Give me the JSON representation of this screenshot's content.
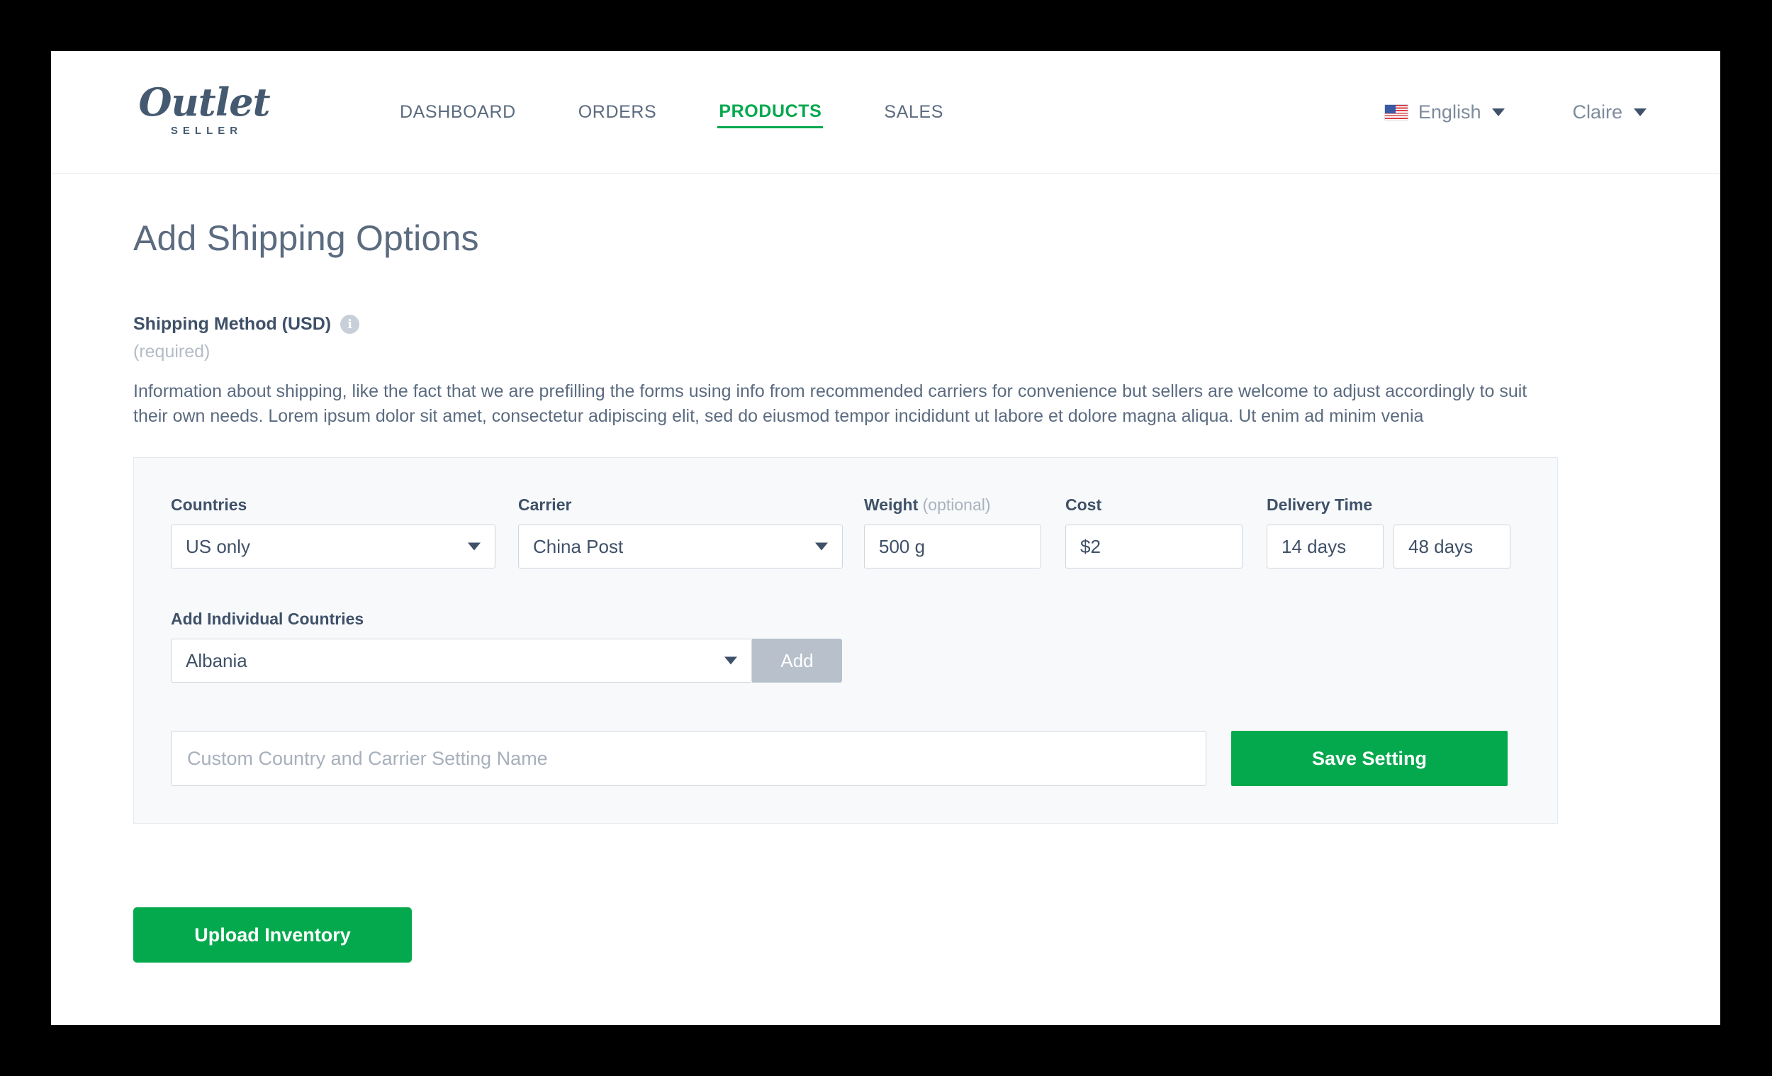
{
  "brand": {
    "logo_word": "Outlet",
    "logo_sub": "SELLER"
  },
  "nav": {
    "items": [
      {
        "label": "DASHBOARD",
        "active": false
      },
      {
        "label": "ORDERS",
        "active": false
      },
      {
        "label": "PRODUCTS",
        "active": true
      },
      {
        "label": "SALES",
        "active": false
      }
    ]
  },
  "header_right": {
    "flag_icon": "us-flag-icon",
    "language": "English",
    "user": "Claire",
    "caret_icon": "chevron-down-icon"
  },
  "page": {
    "title": "Add Shipping Options"
  },
  "section": {
    "title": "Shipping Method (USD)",
    "info_icon": "info-icon",
    "info_glyph": "i",
    "required_note": "(required)",
    "description": "Information about shipping, like the fact that we are prefilling the forms using info from recommended carriers for convenience but sellers are welcome to adjust accordingly to suit their own needs. Lorem ipsum dolor sit amet, consectetur adipiscing elit, sed do eiusmod tempor incididunt ut labore et dolore magna aliqua. Ut enim ad minim venia"
  },
  "form": {
    "countries": {
      "label": "Countries",
      "value": "US only"
    },
    "carrier": {
      "label": "Carrier",
      "value": "China Post"
    },
    "weight": {
      "label": "Weight",
      "label_optional": "(optional)",
      "value": "500 g"
    },
    "cost": {
      "label": "Cost",
      "value": "$2"
    },
    "delivery_time": {
      "label": "Delivery Time",
      "min_value": "14 days",
      "max_value": "48 days"
    },
    "individual_countries": {
      "label": "Add Individual Countries",
      "value": "Albania",
      "add_label": "Add"
    },
    "custom_name": {
      "placeholder": "Custom Country and Carrier Setting Name",
      "value": ""
    },
    "save_label": "Save Setting"
  },
  "footer": {
    "upload_label": "Upload Inventory"
  },
  "colors": {
    "accent_green": "#04a94e",
    "text_navy": "#3f5168",
    "text_muted": "#5b6b80",
    "placeholder": "#a7b0bb",
    "panel_bg": "#f7f9fb",
    "border": "#cfd6de",
    "disabled_btn": "#b7c0cb"
  }
}
